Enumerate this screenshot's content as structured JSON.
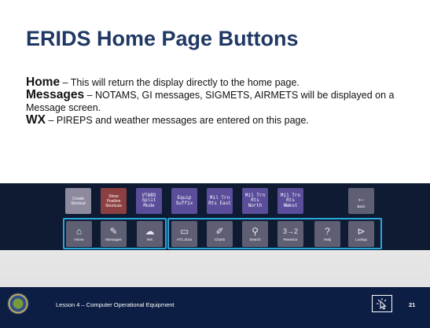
{
  "slide": {
    "title": "ERIDS Home Page Buttons",
    "paragraphs": [
      {
        "term": "Home",
        "text": " – This will return the display directly to the home page."
      },
      {
        "term": "Messages",
        "text": " – NOTAMS, GI messages, SIGMETS, AIRMETS will be displayed on a Message screen."
      },
      {
        "term": "WX",
        "text": " – PIREPS and weather messages are entered on this page."
      }
    ]
  },
  "buttons_row1": [
    {
      "id": "create-shortcut",
      "label": "Create\nShortcut",
      "color": "#8e8a9e"
    },
    {
      "id": "show-position-shortcuts",
      "label": "Show\nPosition\nShortcuts",
      "color": "#8c3f40"
    },
    {
      "id": "vtabs-split-mode",
      "label": "VTABS\nSplit\nMode",
      "color": "#5a4d9a"
    },
    {
      "id": "equip-suffix",
      "label": "Equip\nSuffix",
      "color": "#5a4d9a"
    },
    {
      "id": "mil-trn-rts-east",
      "label": "Mil Trn\nRts East",
      "color": "#5a4d9a"
    },
    {
      "id": "mil-trn-rts-north",
      "label": "Mil Trn\nRts\nNorth",
      "color": "#5a4d9a"
    },
    {
      "id": "mil-trn-rts-nwest",
      "label": "Mil Trn\nRts\nNWest",
      "color": "#5a4d9a"
    },
    {
      "id": "back",
      "label": "Back",
      "icon": "←",
      "color": "#5f5f74"
    }
  ],
  "buttons_row2": [
    {
      "id": "home",
      "label": "Home",
      "icon": "⌂",
      "color": "#5f5f74"
    },
    {
      "id": "messages",
      "label": "Messages",
      "icon": "✎",
      "color": "#5f5f74"
    },
    {
      "id": "wx",
      "label": "WX",
      "icon": "☁",
      "color": "#5f5f74"
    },
    {
      "id": "atc-docs",
      "label": "ATC docs",
      "icon": "▭",
      "color": "#5f5f74"
    },
    {
      "id": "charts",
      "label": "Charts",
      "icon": "✐",
      "color": "#5f5f74"
    },
    {
      "id": "search",
      "label": "Search",
      "icon": "⚲",
      "color": "#5f5f74"
    },
    {
      "id": "resector",
      "label": "Resector",
      "icon": "3→2",
      "color": "#5f5f74"
    },
    {
      "id": "help",
      "label": "Help",
      "icon": "?",
      "color": "#5f5f74"
    },
    {
      "id": "lookup",
      "label": "Lookup",
      "icon": "⊳",
      "color": "#5f5f74"
    }
  ],
  "footer": {
    "lesson_text": "Lesson 4 – Computer Operational Equipment",
    "page_number": "21",
    "logo_icon": "faa-seal-icon",
    "nav_icon": "cursor-click-icon"
  }
}
